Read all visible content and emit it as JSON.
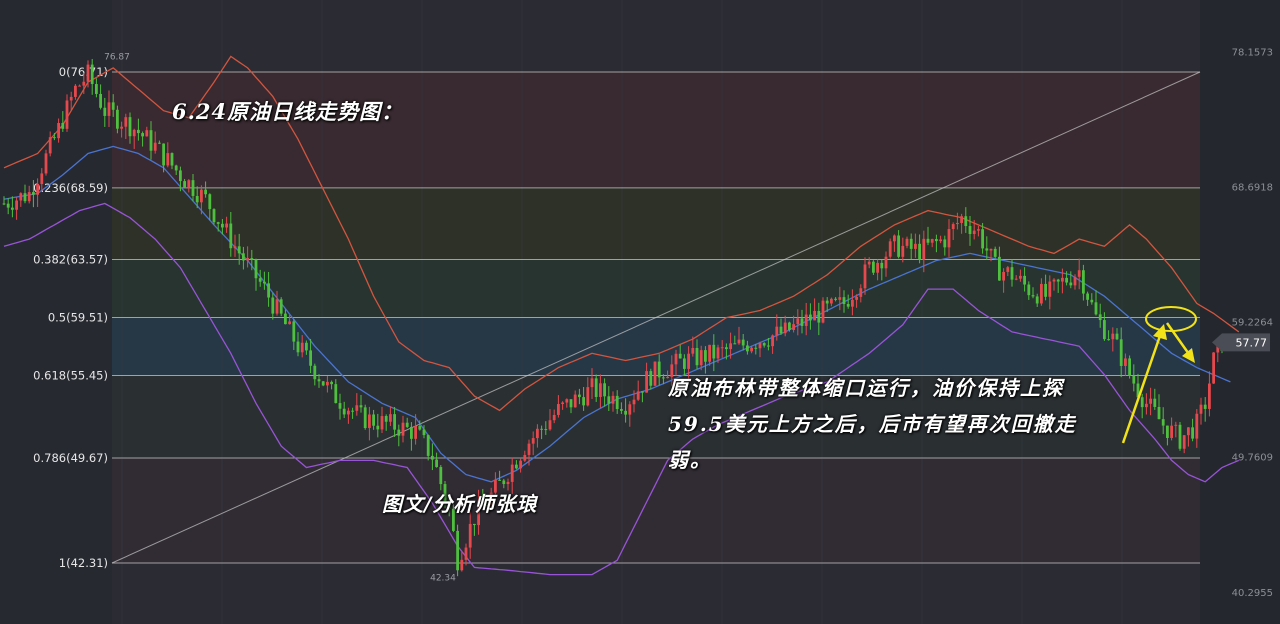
{
  "chart_data": {
    "type": "candlestick",
    "title": "6.24原油日线走势图：",
    "annotation": "原油布林带整体缩口运行，油价保持上探59.5美元上方之后，后市有望再次回撤走弱。",
    "author": "图文/分析师张琅",
    "y_axis": {
      "range": [
        40.2955,
        78.1573
      ],
      "tick_labels": [
        "78.1573",
        "68.6918",
        "59.2264",
        "49.7609",
        "40.2955"
      ]
    },
    "current_price": "57.77",
    "high_label": "76.87",
    "low_label": "42.34",
    "fibonacci": {
      "levels": [
        {
          "label": "0(76.71)",
          "value": 76.71
        },
        {
          "label": "0.236(68.59)",
          "value": 68.59
        },
        {
          "label": "0.382(63.57)",
          "value": 63.57
        },
        {
          "label": "0.5(59.51)",
          "value": 59.51
        },
        {
          "label": "0.618(55.45)",
          "value": 55.45
        },
        {
          "label": "0.786(49.67)",
          "value": 49.67
        },
        {
          "label": "1(42.31)",
          "value": 42.31
        }
      ],
      "band_colors": [
        "#3a2a30",
        "#2f3227",
        "#27352f",
        "#263848",
        "#2a3032",
        "#322c34"
      ]
    },
    "anchors": [
      [
        0,
        67.5
      ],
      [
        6,
        68.2
      ],
      [
        12,
        72.0
      ],
      [
        17,
        75.5
      ],
      [
        20,
        76.5
      ],
      [
        24,
        74.0
      ],
      [
        30,
        73.0
      ],
      [
        36,
        71.5
      ],
      [
        42,
        69.5
      ],
      [
        48,
        67.8
      ],
      [
        55,
        64.5
      ],
      [
        62,
        61.5
      ],
      [
        70,
        57.5
      ],
      [
        78,
        54.2
      ],
      [
        85,
        52.5
      ],
      [
        92,
        52.0
      ],
      [
        98,
        51.5
      ],
      [
        102,
        49.8
      ],
      [
        106,
        46.0
      ],
      [
        108,
        42.6
      ],
      [
        112,
        45.5
      ],
      [
        118,
        47.8
      ],
      [
        124,
        50.5
      ],
      [
        132,
        53.0
      ],
      [
        140,
        54.5
      ],
      [
        148,
        53.5
      ],
      [
        154,
        55.5
      ],
      [
        162,
        56.5
      ],
      [
        170,
        57.0
      ],
      [
        178,
        57.8
      ],
      [
        186,
        58.5
      ],
      [
        194,
        59.8
      ],
      [
        200,
        60.5
      ],
      [
        206,
        63.0
      ],
      [
        212,
        64.5
      ],
      [
        218,
        64.2
      ],
      [
        224,
        65.0
      ],
      [
        228,
        66.5
      ],
      [
        232,
        65.5
      ],
      [
        236,
        63.0
      ],
      [
        240,
        62.5
      ],
      [
        244,
        61.5
      ],
      [
        248,
        61.0
      ],
      [
        252,
        62.0
      ],
      [
        256,
        62.8
      ],
      [
        260,
        59.5
      ],
      [
        264,
        58.0
      ],
      [
        268,
        55.5
      ],
      [
        272,
        53.5
      ],
      [
        276,
        52.0
      ],
      [
        280,
        51.0
      ],
      [
        284,
        52.0
      ],
      [
        286,
        53.5
      ],
      [
        288,
        56.5
      ],
      [
        290,
        57.8
      ]
    ],
    "series": [
      {
        "name": "upper-band",
        "color": "#d2553f",
        "anchors": [
          [
            0,
            70.0
          ],
          [
            8,
            71.0
          ],
          [
            14,
            73.0
          ],
          [
            20,
            76.0
          ],
          [
            26,
            77.0
          ],
          [
            32,
            75.5
          ],
          [
            38,
            74.0
          ],
          [
            44,
            73.5
          ],
          [
            50,
            76.0
          ],
          [
            54,
            77.8
          ],
          [
            58,
            77.0
          ],
          [
            64,
            75.0
          ],
          [
            70,
            72.0
          ],
          [
            76,
            68.5
          ],
          [
            82,
            65.0
          ],
          [
            88,
            61.0
          ],
          [
            94,
            57.8
          ],
          [
            100,
            56.5
          ],
          [
            106,
            56.0
          ],
          [
            112,
            54.0
          ],
          [
            118,
            53.0
          ],
          [
            124,
            54.5
          ],
          [
            132,
            56.0
          ],
          [
            140,
            57.0
          ],
          [
            148,
            56.5
          ],
          [
            156,
            57.0
          ],
          [
            164,
            58.0
          ],
          [
            172,
            59.5
          ],
          [
            180,
            60.0
          ],
          [
            188,
            61.0
          ],
          [
            196,
            62.5
          ],
          [
            204,
            64.5
          ],
          [
            212,
            66.0
          ],
          [
            220,
            67.0
          ],
          [
            228,
            66.5
          ],
          [
            236,
            65.5
          ],
          [
            244,
            64.5
          ],
          [
            250,
            64.0
          ],
          [
            256,
            65.0
          ],
          [
            262,
            64.5
          ],
          [
            268,
            66.0
          ],
          [
            272,
            65.0
          ],
          [
            278,
            63.0
          ],
          [
            284,
            60.5
          ],
          [
            288,
            59.8
          ],
          [
            294,
            58.5
          ]
        ]
      },
      {
        "name": "middle-band",
        "color": "#4a74d0",
        "anchors": [
          [
            0,
            67.8
          ],
          [
            8,
            68.2
          ],
          [
            14,
            69.5
          ],
          [
            20,
            71.0
          ],
          [
            26,
            71.5
          ],
          [
            32,
            71.0
          ],
          [
            38,
            70.0
          ],
          [
            44,
            68.0
          ],
          [
            50,
            66.0
          ],
          [
            58,
            63.5
          ],
          [
            66,
            60.5
          ],
          [
            74,
            57.5
          ],
          [
            82,
            55.0
          ],
          [
            90,
            53.5
          ],
          [
            98,
            52.5
          ],
          [
            104,
            50.0
          ],
          [
            110,
            48.5
          ],
          [
            116,
            48.0
          ],
          [
            122,
            48.8
          ],
          [
            130,
            50.5
          ],
          [
            138,
            52.5
          ],
          [
            146,
            53.8
          ],
          [
            154,
            54.5
          ],
          [
            162,
            55.5
          ],
          [
            170,
            56.5
          ],
          [
            178,
            57.5
          ],
          [
            186,
            58.5
          ],
          [
            196,
            60.0
          ],
          [
            206,
            61.5
          ],
          [
            214,
            62.5
          ],
          [
            222,
            63.5
          ],
          [
            230,
            64.0
          ],
          [
            238,
            63.5
          ],
          [
            246,
            63.0
          ],
          [
            254,
            62.5
          ],
          [
            262,
            61.0
          ],
          [
            270,
            59.0
          ],
          [
            278,
            57.0
          ],
          [
            284,
            56.0
          ],
          [
            288,
            55.5
          ],
          [
            292,
            55.0
          ]
        ]
      },
      {
        "name": "lower-band",
        "color": "#9854d6",
        "anchors": [
          [
            0,
            64.5
          ],
          [
            6,
            65.0
          ],
          [
            12,
            66.0
          ],
          [
            18,
            67.0
          ],
          [
            24,
            67.5
          ],
          [
            30,
            66.5
          ],
          [
            36,
            65.0
          ],
          [
            42,
            63.0
          ],
          [
            48,
            60.0
          ],
          [
            54,
            57.0
          ],
          [
            60,
            53.5
          ],
          [
            66,
            50.5
          ],
          [
            72,
            49.0
          ],
          [
            80,
            49.5
          ],
          [
            88,
            49.5
          ],
          [
            96,
            49.0
          ],
          [
            102,
            46.5
          ],
          [
            108,
            43.5
          ],
          [
            112,
            42.0
          ],
          [
            120,
            41.8
          ],
          [
            130,
            41.5
          ],
          [
            140,
            41.5
          ],
          [
            146,
            42.5
          ],
          [
            152,
            46.0
          ],
          [
            158,
            49.5
          ],
          [
            164,
            51.0
          ],
          [
            170,
            52.0
          ],
          [
            178,
            53.0
          ],
          [
            186,
            54.0
          ],
          [
            196,
            55.0
          ],
          [
            206,
            57.0
          ],
          [
            214,
            59.0
          ],
          [
            220,
            61.5
          ],
          [
            226,
            61.5
          ],
          [
            232,
            60.0
          ],
          [
            240,
            58.5
          ],
          [
            248,
            58.0
          ],
          [
            256,
            57.5
          ],
          [
            262,
            55.5
          ],
          [
            268,
            53.0
          ],
          [
            274,
            51.0
          ],
          [
            278,
            49.5
          ],
          [
            282,
            48.5
          ],
          [
            286,
            48.0
          ],
          [
            290,
            49.0
          ],
          [
            294,
            49.5
          ]
        ]
      }
    ]
  }
}
